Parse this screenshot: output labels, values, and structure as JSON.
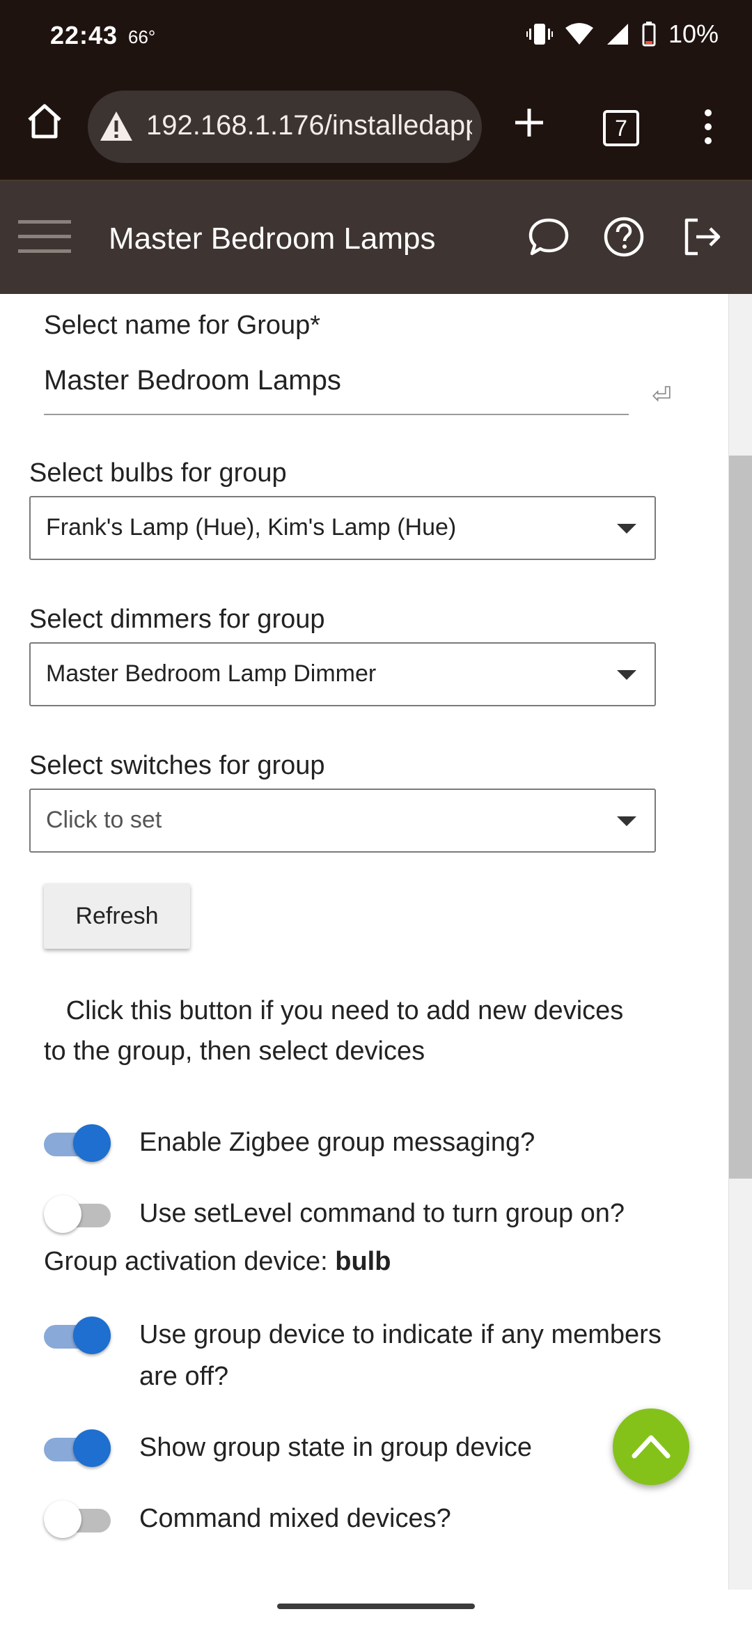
{
  "status_bar": {
    "time": "22:43",
    "temperature": "66°",
    "battery": "10%"
  },
  "browser": {
    "url": "192.168.1.176/installedapp",
    "tab_count": "7"
  },
  "header": {
    "title": "Master Bedroom Lamps"
  },
  "form": {
    "name_label": "Select name for Group*",
    "name_value": "Master Bedroom Lamps",
    "bulbs_label": "Select bulbs for group",
    "bulbs_value": "Frank's Lamp (Hue), Kim's Lamp (Hue)",
    "dimmers_label": "Select dimmers for group",
    "dimmers_value": "Master Bedroom Lamp Dimmer",
    "switches_label": "Select switches for group",
    "switches_placeholder": "Click to set",
    "refresh_label": "Refresh",
    "help_text": "Click this button if you need to add new devices to the group, then select devices",
    "activation_prefix": "Group activation device: ",
    "activation_value": "bulb"
  },
  "toggles": [
    {
      "label": "Enable Zigbee group messaging?",
      "on": true
    },
    {
      "label": "Use setLevel command to turn group on?",
      "on": false
    },
    {
      "label": "Use group device to indicate if any members are off?",
      "on": true
    },
    {
      "label": "Show group state in group device",
      "on": true
    },
    {
      "label": "Command mixed devices?",
      "on": false
    }
  ],
  "colors": {
    "top_bar": "#1f130f",
    "app_header": "#3e3431",
    "toggle_on": "#1e6fcf",
    "fab": "#84c21a"
  },
  "icons": [
    "home-icon",
    "warning-icon",
    "new-tab-icon",
    "tab-switcher-icon",
    "more-vert-icon",
    "menu-icon",
    "chat-icon",
    "help-icon",
    "logout-icon",
    "chevron-up-icon"
  ]
}
